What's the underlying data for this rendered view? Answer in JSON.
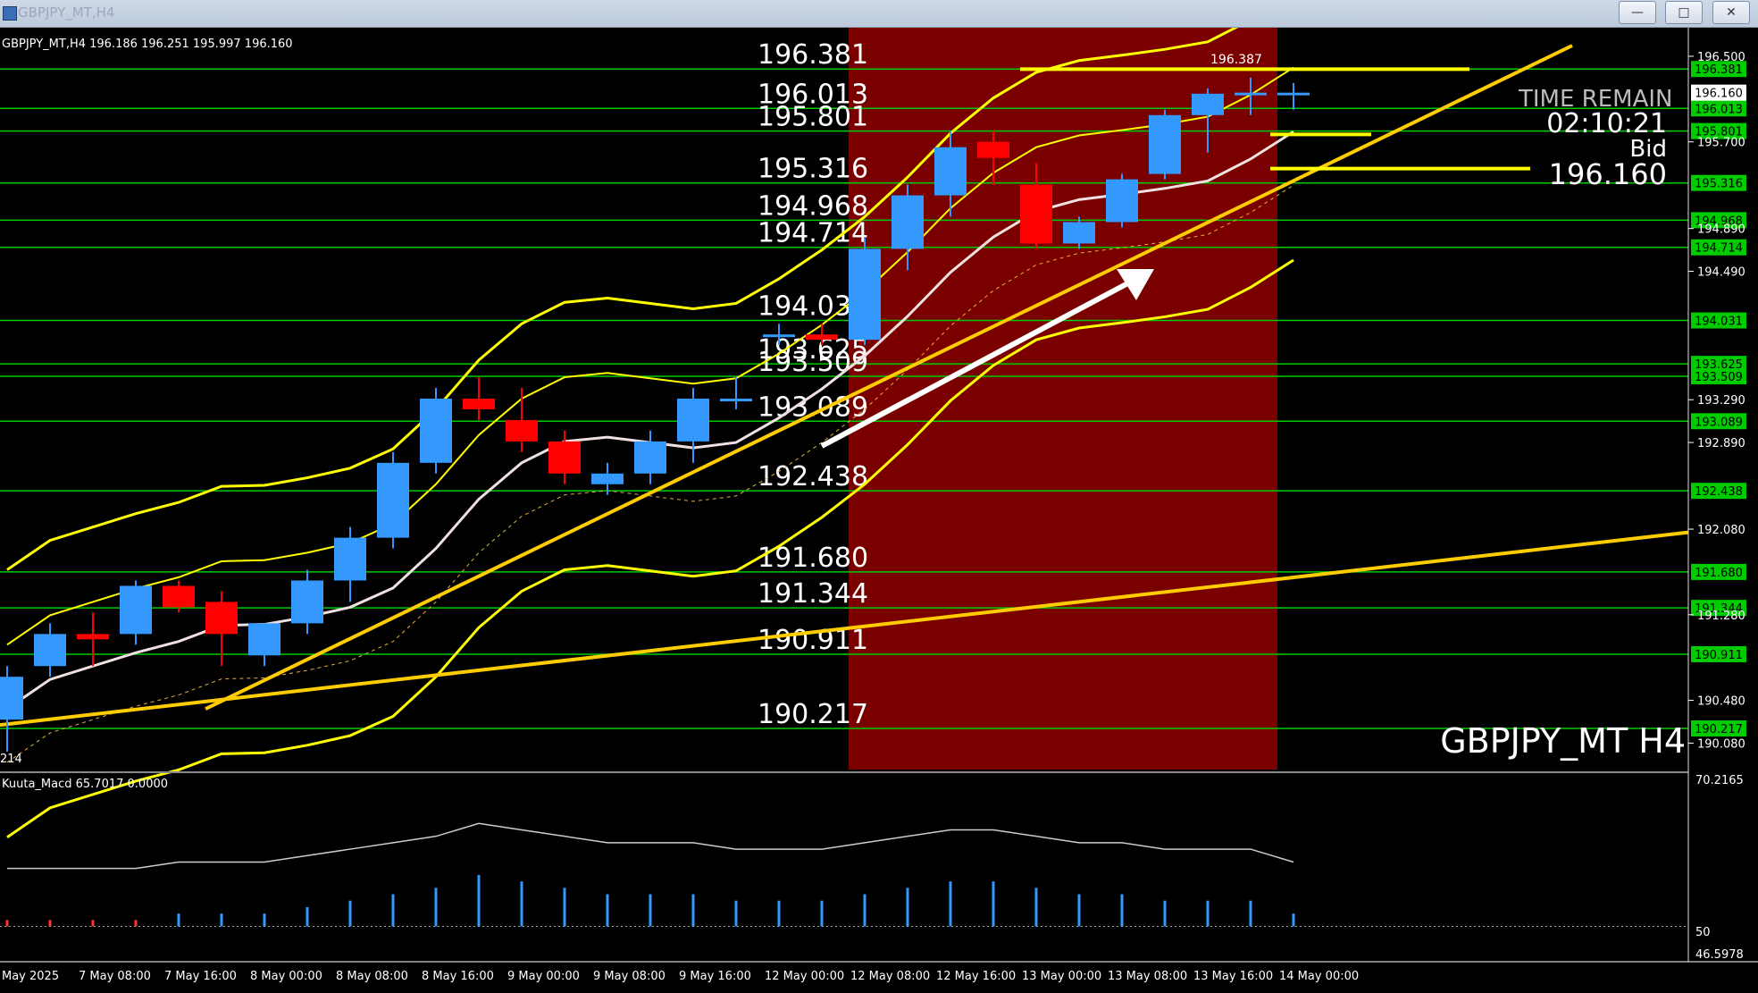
{
  "window": {
    "title": "GBPJPY_MT,H4",
    "minimize_label": "—",
    "maximize_label": "□",
    "close_label": "✕"
  },
  "header": {
    "ohlc": "GBPJPY_MT,H4  196.186 196.251 195.997 196.160"
  },
  "colors": {
    "background": "#000000",
    "bull": "#3399ff",
    "bear": "#ff0000",
    "level_line": "#00cc00",
    "band": "#ffff00",
    "trend": "#ffcc00",
    "highlight": "#7a0000",
    "axis_text": "#ffffff"
  },
  "levels": [
    {
      "label": "196.381"
    },
    {
      "label": "196.013"
    },
    {
      "label": "195.801"
    },
    {
      "label": "195.316"
    },
    {
      "label": "194.968"
    },
    {
      "label": "194.714"
    },
    {
      "label": "194.031"
    },
    {
      "label": "193.625"
    },
    {
      "label": "193.509"
    },
    {
      "label": "193.089"
    },
    {
      "label": "192.438"
    },
    {
      "label": "191.680"
    },
    {
      "label": "191.344"
    },
    {
      "label": "190.911"
    },
    {
      "label": "190.217"
    }
  ],
  "price_axis": {
    "ticks": [
      "196.500",
      "195.700",
      "194.890",
      "194.490",
      "193.290",
      "192.890",
      "192.080",
      "191.280",
      "190.480",
      "190.080"
    ],
    "current": "196.160"
  },
  "overlay": {
    "time_remain_label": "TIME REMAIN",
    "time_remain_value": "02:10:21",
    "bid_label": "Bid",
    "bid_value": "196.160",
    "symbol_label": "GBPJPY_MT H4",
    "high_marker": "196.387",
    "left_edge_value": "214"
  },
  "sub_window": {
    "title": "Kuuta_Macd 65.7017  0.0000",
    "axis_top": "70.2165",
    "axis_mid": "50",
    "axis_bottom": "46.5978"
  },
  "time_axis": [
    "May 2025",
    "7 May 08:00",
    "7 May 16:00",
    "8 May 00:00",
    "8 May 08:00",
    "8 May 16:00",
    "9 May 00:00",
    "9 May 08:00",
    "9 May 16:00",
    "12 May 00:00",
    "12 May 08:00",
    "12 May 16:00",
    "13 May 00:00",
    "13 May 08:00",
    "13 May 16:00",
    "14 May 00:00"
  ],
  "chart_data": {
    "type": "candlestick",
    "title": "GBPJPY_MT,H4",
    "xlabel": "",
    "ylabel": "",
    "ylim": [
      190.0,
      196.6
    ],
    "candles": [
      {
        "o": 190.3,
        "h": 190.8,
        "l": 190.0,
        "c": 190.7
      },
      {
        "o": 190.8,
        "h": 191.2,
        "l": 190.7,
        "c": 191.1
      },
      {
        "o": 191.1,
        "h": 191.3,
        "l": 190.8,
        "c": 191.05
      },
      {
        "o": 191.1,
        "h": 191.6,
        "l": 191.0,
        "c": 191.55
      },
      {
        "o": 191.55,
        "h": 191.6,
        "l": 191.3,
        "c": 191.35
      },
      {
        "o": 191.4,
        "h": 191.5,
        "l": 190.8,
        "c": 191.1
      },
      {
        "o": 190.9,
        "h": 191.2,
        "l": 190.8,
        "c": 191.2
      },
      {
        "o": 191.2,
        "h": 191.7,
        "l": 191.1,
        "c": 191.6
      },
      {
        "o": 191.6,
        "h": 192.1,
        "l": 191.4,
        "c": 192.0
      },
      {
        "o": 192.0,
        "h": 192.8,
        "l": 191.9,
        "c": 192.7
      },
      {
        "o": 192.7,
        "h": 193.4,
        "l": 192.6,
        "c": 193.3
      },
      {
        "o": 193.3,
        "h": 193.5,
        "l": 193.1,
        "c": 193.2
      },
      {
        "o": 193.1,
        "h": 193.4,
        "l": 192.8,
        "c": 192.9
      },
      {
        "o": 192.9,
        "h": 193.0,
        "l": 192.5,
        "c": 192.6
      },
      {
        "o": 192.5,
        "h": 192.7,
        "l": 192.4,
        "c": 192.6
      },
      {
        "o": 192.6,
        "h": 193.0,
        "l": 192.5,
        "c": 192.9
      },
      {
        "o": 192.9,
        "h": 193.4,
        "l": 192.7,
        "c": 193.3
      },
      {
        "o": 193.3,
        "h": 193.5,
        "l": 193.2,
        "c": 193.3
      },
      {
        "o": 193.9,
        "h": 194.0,
        "l": 193.8,
        "c": 193.9
      },
      {
        "o": 193.9,
        "h": 194.0,
        "l": 193.8,
        "c": 193.85
      },
      {
        "o": 193.85,
        "h": 194.8,
        "l": 193.8,
        "c": 194.7
      },
      {
        "o": 194.7,
        "h": 195.3,
        "l": 194.5,
        "c": 195.2
      },
      {
        "o": 195.2,
        "h": 195.8,
        "l": 195.0,
        "c": 195.65
      },
      {
        "o": 195.7,
        "h": 195.8,
        "l": 195.3,
        "c": 195.55
      },
      {
        "o": 195.3,
        "h": 195.5,
        "l": 194.7,
        "c": 194.75
      },
      {
        "o": 194.75,
        "h": 195.0,
        "l": 194.7,
        "c": 194.95
      },
      {
        "o": 194.95,
        "h": 195.4,
        "l": 194.9,
        "c": 195.35
      },
      {
        "o": 195.4,
        "h": 196.0,
        "l": 195.35,
        "c": 195.95
      },
      {
        "o": 195.95,
        "h": 196.2,
        "l": 195.6,
        "c": 196.15
      },
      {
        "o": 196.16,
        "h": 196.3,
        "l": 195.95,
        "c": 196.16
      },
      {
        "o": 196.16,
        "h": 196.25,
        "l": 196.0,
        "c": 196.16
      }
    ],
    "macd_histogram": [
      51,
      51,
      51,
      51,
      52,
      52,
      52,
      53,
      54,
      55,
      56,
      58,
      57,
      56,
      55,
      55,
      55,
      54,
      54,
      54,
      55,
      56,
      57,
      57,
      56,
      55,
      55,
      54,
      54,
      54,
      52
    ]
  }
}
